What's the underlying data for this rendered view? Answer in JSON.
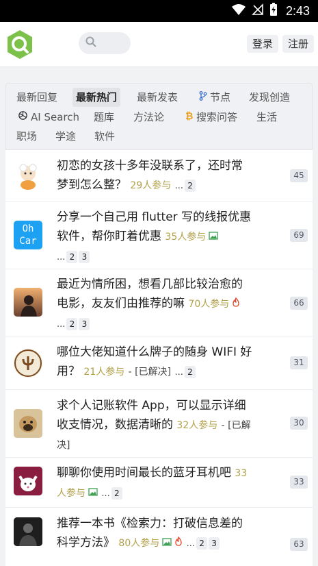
{
  "status": {
    "time": "2:43"
  },
  "header": {
    "login": "登录",
    "register": "注册"
  },
  "tabs": [
    {
      "label": "最新回复"
    },
    {
      "label": "最新热门"
    },
    {
      "label": "最新发表"
    },
    {
      "label": "节点"
    },
    {
      "label": "发现创造"
    },
    {
      "label": "AI Search"
    },
    {
      "label": "题库"
    },
    {
      "label": "方法论"
    },
    {
      "label": "搜索问答"
    },
    {
      "label": "生活"
    },
    {
      "label": "职场"
    },
    {
      "label": "学途"
    },
    {
      "label": "软件"
    }
  ],
  "topics": [
    {
      "line1": "初恋的女孩十多年没联系了，还时常",
      "line2": "梦到怎么整？",
      "participants": "29人参与",
      "ellipsis": "...",
      "pages": [
        "2"
      ],
      "count": "45"
    },
    {
      "avatar_text": "Oh Car",
      "line1": "分享一个自己用 flutter 写的线报优惠",
      "line2": "软件，帮你盯着优惠",
      "participants": "35人参与",
      "ellipsis": "...",
      "pages": [
        "2",
        "3"
      ],
      "count": "69"
    },
    {
      "line1": "最近为情所困，想看几部比较治愈的",
      "line2": "电影，友友们由推荐的嘛",
      "participants": "70人参与",
      "ellipsis": "...",
      "pages": [
        "2",
        "3"
      ],
      "count": "66"
    },
    {
      "line1": "哪位大佬知道什么牌子的随身 WIFI 好",
      "line2": "用？",
      "participants": "21人参与",
      "solved": "- [已解决]",
      "ellipsis": "...",
      "pages": [
        "2"
      ],
      "count": "31"
    },
    {
      "line1": "求个人记账软件 App，可以显示详细",
      "line2": "收支情况，数据清晰的",
      "participants": "32人参与",
      "solved": "- [已解",
      "solved2": "决]",
      "count": "30"
    },
    {
      "line1": "聊聊你使用时间最长的蓝牙耳机吧",
      "participants": "33",
      "participants2": "人参与",
      "ellipsis": "...",
      "pages": [
        "2"
      ],
      "count": "33"
    },
    {
      "line1": "推荐一本书《检索力：打破信息差的",
      "line2": "科学方法》",
      "participants": "80人参与",
      "ellipsis": "...",
      "pages": [
        "2",
        "3"
      ],
      "count": "63"
    }
  ]
}
